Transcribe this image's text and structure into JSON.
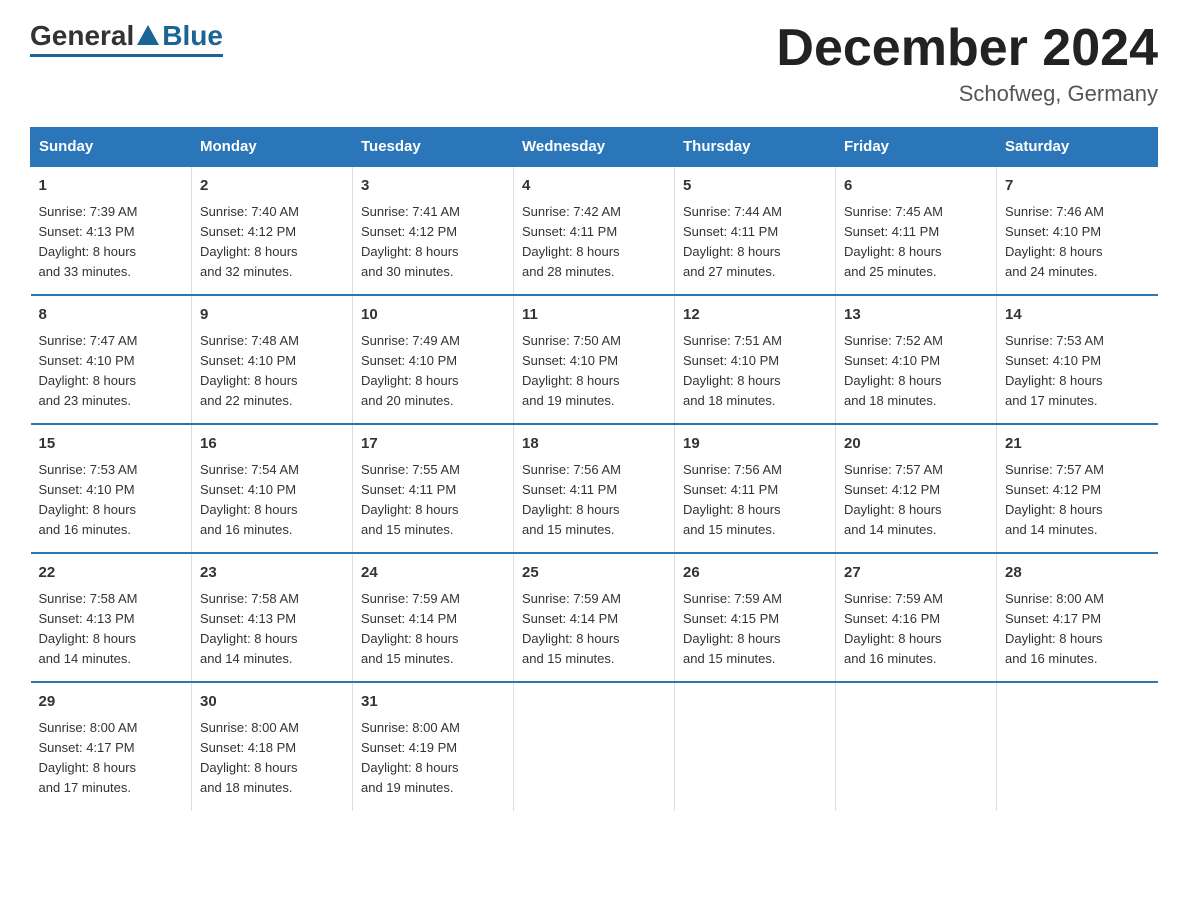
{
  "header": {
    "logo_general": "General",
    "logo_blue": "Blue",
    "month_title": "December 2024",
    "location": "Schofweg, Germany"
  },
  "weekdays": [
    "Sunday",
    "Monday",
    "Tuesday",
    "Wednesday",
    "Thursday",
    "Friday",
    "Saturday"
  ],
  "weeks": [
    [
      {
        "day": "1",
        "sunrise": "7:39 AM",
        "sunset": "4:13 PM",
        "daylight": "8 hours and 33 minutes."
      },
      {
        "day": "2",
        "sunrise": "7:40 AM",
        "sunset": "4:12 PM",
        "daylight": "8 hours and 32 minutes."
      },
      {
        "day": "3",
        "sunrise": "7:41 AM",
        "sunset": "4:12 PM",
        "daylight": "8 hours and 30 minutes."
      },
      {
        "day": "4",
        "sunrise": "7:42 AM",
        "sunset": "4:11 PM",
        "daylight": "8 hours and 28 minutes."
      },
      {
        "day": "5",
        "sunrise": "7:44 AM",
        "sunset": "4:11 PM",
        "daylight": "8 hours and 27 minutes."
      },
      {
        "day": "6",
        "sunrise": "7:45 AM",
        "sunset": "4:11 PM",
        "daylight": "8 hours and 25 minutes."
      },
      {
        "day": "7",
        "sunrise": "7:46 AM",
        "sunset": "4:10 PM",
        "daylight": "8 hours and 24 minutes."
      }
    ],
    [
      {
        "day": "8",
        "sunrise": "7:47 AM",
        "sunset": "4:10 PM",
        "daylight": "8 hours and 23 minutes."
      },
      {
        "day": "9",
        "sunrise": "7:48 AM",
        "sunset": "4:10 PM",
        "daylight": "8 hours and 22 minutes."
      },
      {
        "day": "10",
        "sunrise": "7:49 AM",
        "sunset": "4:10 PM",
        "daylight": "8 hours and 20 minutes."
      },
      {
        "day": "11",
        "sunrise": "7:50 AM",
        "sunset": "4:10 PM",
        "daylight": "8 hours and 19 minutes."
      },
      {
        "day": "12",
        "sunrise": "7:51 AM",
        "sunset": "4:10 PM",
        "daylight": "8 hours and 18 minutes."
      },
      {
        "day": "13",
        "sunrise": "7:52 AM",
        "sunset": "4:10 PM",
        "daylight": "8 hours and 18 minutes."
      },
      {
        "day": "14",
        "sunrise": "7:53 AM",
        "sunset": "4:10 PM",
        "daylight": "8 hours and 17 minutes."
      }
    ],
    [
      {
        "day": "15",
        "sunrise": "7:53 AM",
        "sunset": "4:10 PM",
        "daylight": "8 hours and 16 minutes."
      },
      {
        "day": "16",
        "sunrise": "7:54 AM",
        "sunset": "4:10 PM",
        "daylight": "8 hours and 16 minutes."
      },
      {
        "day": "17",
        "sunrise": "7:55 AM",
        "sunset": "4:11 PM",
        "daylight": "8 hours and 15 minutes."
      },
      {
        "day": "18",
        "sunrise": "7:56 AM",
        "sunset": "4:11 PM",
        "daylight": "8 hours and 15 minutes."
      },
      {
        "day": "19",
        "sunrise": "7:56 AM",
        "sunset": "4:11 PM",
        "daylight": "8 hours and 15 minutes."
      },
      {
        "day": "20",
        "sunrise": "7:57 AM",
        "sunset": "4:12 PM",
        "daylight": "8 hours and 14 minutes."
      },
      {
        "day": "21",
        "sunrise": "7:57 AM",
        "sunset": "4:12 PM",
        "daylight": "8 hours and 14 minutes."
      }
    ],
    [
      {
        "day": "22",
        "sunrise": "7:58 AM",
        "sunset": "4:13 PM",
        "daylight": "8 hours and 14 minutes."
      },
      {
        "day": "23",
        "sunrise": "7:58 AM",
        "sunset": "4:13 PM",
        "daylight": "8 hours and 14 minutes."
      },
      {
        "day": "24",
        "sunrise": "7:59 AM",
        "sunset": "4:14 PM",
        "daylight": "8 hours and 15 minutes."
      },
      {
        "day": "25",
        "sunrise": "7:59 AM",
        "sunset": "4:14 PM",
        "daylight": "8 hours and 15 minutes."
      },
      {
        "day": "26",
        "sunrise": "7:59 AM",
        "sunset": "4:15 PM",
        "daylight": "8 hours and 15 minutes."
      },
      {
        "day": "27",
        "sunrise": "7:59 AM",
        "sunset": "4:16 PM",
        "daylight": "8 hours and 16 minutes."
      },
      {
        "day": "28",
        "sunrise": "8:00 AM",
        "sunset": "4:17 PM",
        "daylight": "8 hours and 16 minutes."
      }
    ],
    [
      {
        "day": "29",
        "sunrise": "8:00 AM",
        "sunset": "4:17 PM",
        "daylight": "8 hours and 17 minutes."
      },
      {
        "day": "30",
        "sunrise": "8:00 AM",
        "sunset": "4:18 PM",
        "daylight": "8 hours and 18 minutes."
      },
      {
        "day": "31",
        "sunrise": "8:00 AM",
        "sunset": "4:19 PM",
        "daylight": "8 hours and 19 minutes."
      },
      null,
      null,
      null,
      null
    ]
  ],
  "labels": {
    "sunrise": "Sunrise:",
    "sunset": "Sunset:",
    "daylight": "Daylight:"
  }
}
